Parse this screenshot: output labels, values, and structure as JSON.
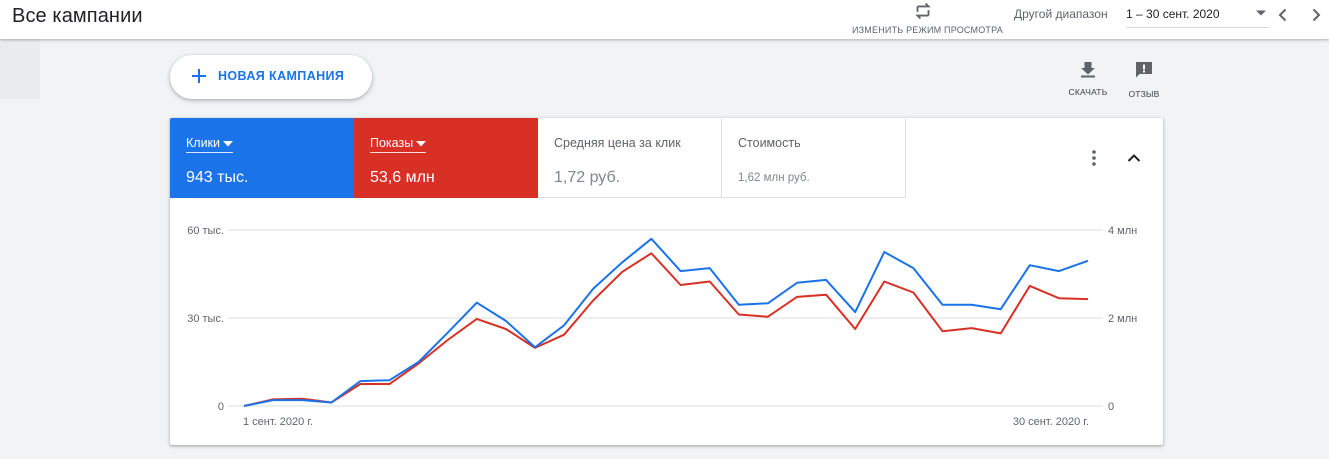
{
  "header": {
    "title": "Все кампании",
    "view_toggle_label": "ИЗМЕНИТЬ РЕЖИМ ПРОСМОТРА",
    "range_label": "Другой диапазон",
    "range_value": "1 – 30 сент. 2020"
  },
  "toolbar": {
    "new_campaign_label": "НОВАЯ КАМПАНИЯ",
    "download_label": "СКАЧАТЬ",
    "feedback_label": "ОТЗЫВ"
  },
  "metrics": {
    "clicks": {
      "label": "Клики",
      "value": "943 тыс."
    },
    "impressions": {
      "label": "Показы",
      "value": "53,6 млн"
    },
    "avg_cpc": {
      "label": "Средняя цена за клик",
      "value": "1,72 руб."
    },
    "cost": {
      "label": "Стоимость",
      "value": "1,62 млн руб."
    }
  },
  "colors": {
    "clicks": "#1a73e8",
    "impressions": "#d93025"
  },
  "chart_data": {
    "type": "line",
    "x_start_label": "1 сент. 2020 г.",
    "x_end_label": "30 сент. 2020 г.",
    "left_axis": {
      "ticks": [
        "0",
        "30 тыс.",
        "60 тыс."
      ],
      "range": [
        0,
        60000
      ]
    },
    "right_axis": {
      "ticks": [
        "0",
        "2 млн",
        "4 млн"
      ],
      "range": [
        0,
        4000000
      ]
    },
    "grid": true,
    "series": [
      {
        "name": "Клики",
        "axis": "left",
        "values": [
          0,
          2000,
          2000,
          1200,
          8500,
          8800,
          15000,
          25000,
          35200,
          29000,
          20000,
          27500,
          40000,
          49000,
          57000,
          46000,
          47000,
          34500,
          35000,
          42000,
          43000,
          32000,
          52500,
          47000,
          34500,
          34500,
          33000,
          48000,
          46000,
          49500
        ]
      },
      {
        "name": "Показы",
        "axis": "right",
        "values": [
          0,
          150000,
          166667,
          80000,
          500000,
          500000,
          966667,
          1500000,
          1980000,
          1750000,
          1320000,
          1620000,
          2400000,
          3050000,
          3470000,
          2750000,
          2830000,
          2080000,
          2030000,
          2480000,
          2530000,
          1750000,
          2830000,
          2580000,
          1700000,
          1770000,
          1650000,
          2730000,
          2450000,
          2430000
        ]
      }
    ]
  }
}
